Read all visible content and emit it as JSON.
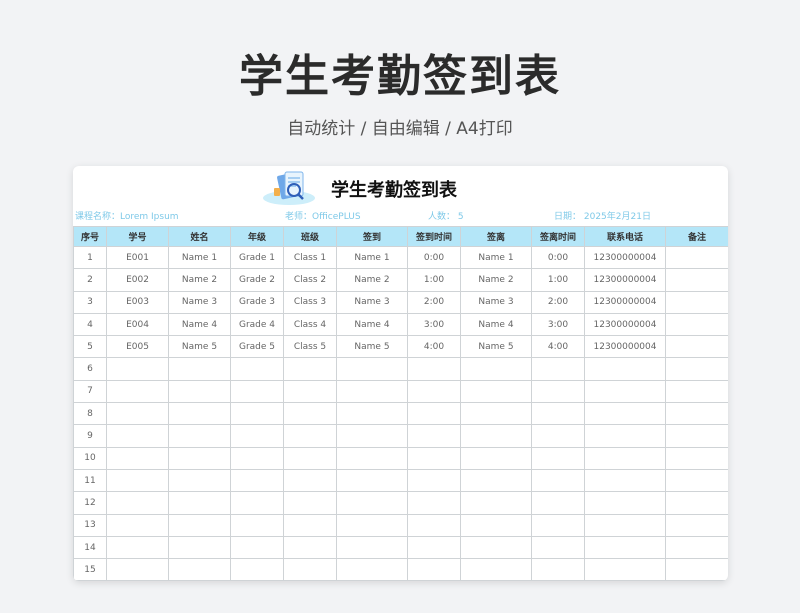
{
  "page": {
    "title": "学生考勤签到表",
    "subtitle": "自动统计 / 自由编辑 / A4打印"
  },
  "sheet": {
    "title": "学生考勤签到表",
    "info": {
      "course": "课程名称：Lorem Ipsum",
      "teacher": "老师：OfficePLUS",
      "count": "人数：  5",
      "date": "日期：  2025年2月21日"
    },
    "headers": [
      "序号",
      "学号",
      "姓名",
      "年级",
      "班级",
      "签到",
      "签到时间",
      "签离",
      "签离时间",
      "联系电话",
      "备注"
    ],
    "rows": [
      [
        "1",
        "E001",
        "Name 1",
        "Grade 1",
        "Class 1",
        "Name 1",
        "0:00",
        "Name 1",
        "0:00",
        "12300000004",
        ""
      ],
      [
        "2",
        "E002",
        "Name 2",
        "Grade 2",
        "Class 2",
        "Name 2",
        "1:00",
        "Name 2",
        "1:00",
        "12300000004",
        ""
      ],
      [
        "3",
        "E003",
        "Name 3",
        "Grade 3",
        "Class 3",
        "Name 3",
        "2:00",
        "Name 3",
        "2:00",
        "12300000004",
        ""
      ],
      [
        "4",
        "E004",
        "Name 4",
        "Grade 4",
        "Class 4",
        "Name 4",
        "3:00",
        "Name 4",
        "3:00",
        "12300000004",
        ""
      ],
      [
        "5",
        "E005",
        "Name 5",
        "Grade 5",
        "Class 5",
        "Name 5",
        "4:00",
        "Name 5",
        "4:00",
        "12300000004",
        ""
      ],
      [
        "6",
        "",
        "",
        "",
        "",
        "",
        "",
        "",
        "",
        "",
        ""
      ],
      [
        "7",
        "",
        "",
        "",
        "",
        "",
        "",
        "",
        "",
        "",
        ""
      ],
      [
        "8",
        "",
        "",
        "",
        "",
        "",
        "",
        "",
        "",
        "",
        ""
      ],
      [
        "9",
        "",
        "",
        "",
        "",
        "",
        "",
        "",
        "",
        "",
        ""
      ],
      [
        "10",
        "",
        "",
        "",
        "",
        "",
        "",
        "",
        "",
        "",
        ""
      ],
      [
        "11",
        "",
        "",
        "",
        "",
        "",
        "",
        "",
        "",
        "",
        ""
      ],
      [
        "12",
        "",
        "",
        "",
        "",
        "",
        "",
        "",
        "",
        "",
        ""
      ],
      [
        "13",
        "",
        "",
        "",
        "",
        "",
        "",
        "",
        "",
        "",
        ""
      ],
      [
        "14",
        "",
        "",
        "",
        "",
        "",
        "",
        "",
        "",
        "",
        ""
      ],
      [
        "15",
        "",
        "",
        "",
        "",
        "",
        "",
        "",
        "",
        "",
        ""
      ]
    ]
  },
  "colors": {
    "header_bg": "#b4e6f8",
    "info_text": "#7fc9e8",
    "page_bg": "#f2f3f5"
  }
}
